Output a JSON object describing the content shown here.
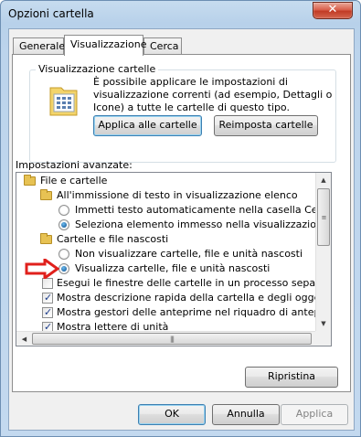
{
  "window": {
    "title": "Opzioni cartella",
    "close_label": "✕"
  },
  "tabs": [
    {
      "label": "Generale",
      "active": false
    },
    {
      "label": "Visualizzazione",
      "active": true
    },
    {
      "label": "Cerca",
      "active": false
    }
  ],
  "folder_views": {
    "group_title": "Visualizzazione cartelle",
    "description": "È possibile applicare le impostazioni di visualizzazione correnti (ad esempio, Dettagli o Icone) a tutte le cartelle di questo tipo.",
    "apply_button": "Applica alle cartelle",
    "reset_button": "Reimposta cartelle"
  },
  "advanced": {
    "label": "Impostazioni avanzate:",
    "items": [
      {
        "type": "folder",
        "level": 0,
        "label": "File e cartelle"
      },
      {
        "type": "folder",
        "level": 1,
        "label": "All'immissione di testo in visualizzazione elenco"
      },
      {
        "type": "radio",
        "level": 2,
        "checked": false,
        "label": "Immetti testo automaticamente nella casella Cerca"
      },
      {
        "type": "radio",
        "level": 2,
        "checked": true,
        "label": "Seleziona elemento immesso nella visualizzazione"
      },
      {
        "type": "folder",
        "level": 1,
        "label": "Cartelle e file nascosti"
      },
      {
        "type": "radio",
        "level": 2,
        "checked": false,
        "label": "Non visualizzare cartelle, file e unità nascosti"
      },
      {
        "type": "radio",
        "level": 2,
        "checked": true,
        "label": "Visualizza cartelle, file e unità nascosti"
      },
      {
        "type": "checkbox",
        "level": 1,
        "checked": false,
        "label": "Esegui le finestre delle cartelle in un processo separato"
      },
      {
        "type": "checkbox",
        "level": 1,
        "checked": true,
        "label": "Mostra descrizione rapida della cartella e degli oggetti del"
      },
      {
        "type": "checkbox",
        "level": 1,
        "checked": true,
        "label": "Mostra gestori delle anteprime nel riquadro di anteprima"
      },
      {
        "type": "checkbox",
        "level": 1,
        "checked": true,
        "label": "Mostra lettere di unità"
      }
    ],
    "restore_button": "Ripristina"
  },
  "footer": {
    "ok": "OK",
    "cancel": "Annulla",
    "apply": "Applica"
  },
  "colors": {
    "annotation_arrow": "#e0201c",
    "title_bar": "#b8d1ea"
  }
}
